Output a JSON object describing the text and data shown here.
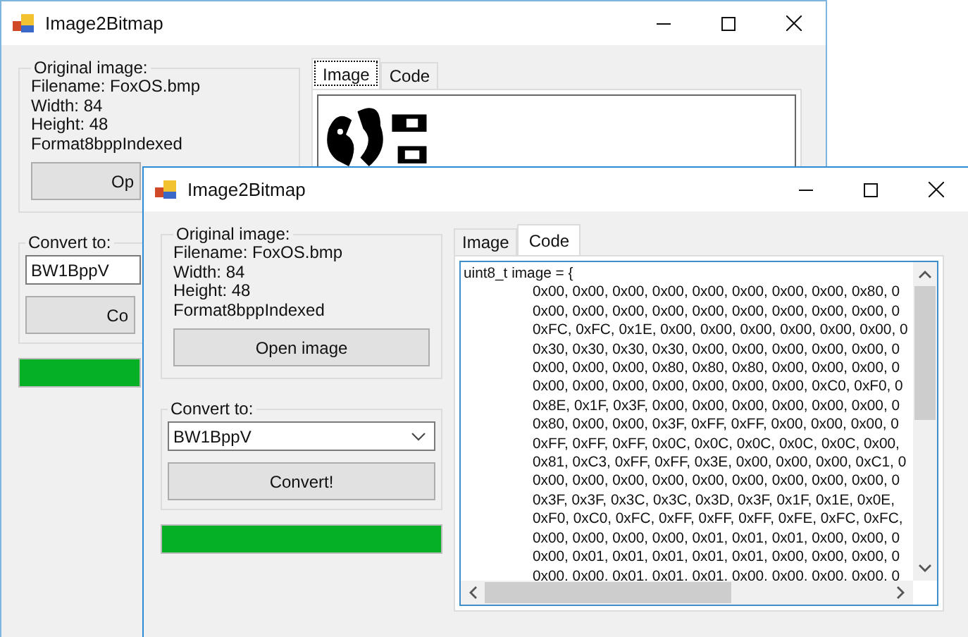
{
  "windows": [
    {
      "title": "Image2Bitmap",
      "active": false,
      "original_image": {
        "label": "Original image:",
        "lines": [
          "Filename: FoxOS.bmp",
          "Width:  84",
          "Height: 48",
          "Format8bppIndexed"
        ],
        "button": "Op"
      },
      "convert": {
        "label": "Convert to:",
        "value": "BW1BppV",
        "button": "Co"
      },
      "progress": {
        "level": 1
      },
      "tabs": [
        {
          "label": "Image",
          "selected": true
        },
        {
          "label": "Code",
          "selected": false
        }
      ]
    },
    {
      "title": "Image2Bitmap",
      "active": true,
      "original_image": {
        "label": "Original image:",
        "lines": [
          "Filename: FoxOS.bmp",
          "Width:  84",
          "Height: 48",
          "Format8bppIndexed"
        ],
        "button": "Open image"
      },
      "convert": {
        "label": "Convert to:",
        "value": "BW1BppV",
        "button": "Convert!"
      },
      "progress": {
        "level": 1
      },
      "tabs": [
        {
          "label": "Image",
          "selected": false
        },
        {
          "label": "Code",
          "selected": true
        }
      ],
      "panel": {
        "kind": "code",
        "lines": [
          "uint8_t image = {",
          "0x00, 0x00, 0x00, 0x00, 0x00, 0x00, 0x00, 0x00, 0x80, 0",
          "0x00, 0x00, 0x00, 0x00, 0x00, 0x00, 0x00, 0x00, 0x00, 0",
          "0xFC, 0xFC, 0x1E, 0x00, 0x00, 0x00, 0x00, 0x00, 0x00, 0",
          "0x30, 0x30, 0x30, 0x30, 0x00, 0x00, 0x00, 0x00, 0x00, 0",
          "0x00, 0x00, 0x00, 0x80, 0x80, 0x80, 0x00, 0x00, 0x00, 0",
          "0x00, 0x00, 0x00, 0x00, 0x00, 0x00, 0x00, 0xC0, 0xF0, 0",
          "0x8E, 0x1F, 0x3F, 0x00, 0x00, 0x00, 0x00, 0x00, 0x00, 0",
          "0x80, 0x00, 0x00, 0x3F, 0xFF, 0xFF, 0x00, 0x00, 0x00, 0",
          "0xFF, 0xFF, 0xFF, 0x0C, 0x0C, 0x0C, 0x0C, 0x0C, 0x00,",
          "0x81, 0xC3, 0xFF, 0xFF, 0x3E, 0x00, 0x00, 0x00, 0xC1, 0",
          "0x00, 0x00, 0x00, 0x00, 0x00, 0x00, 0x00, 0x00, 0x00, 0",
          "0x3F, 0x3F, 0x3C, 0x3C, 0x3D, 0x3F, 0x1F, 0x1E, 0x0E,",
          "0xF0, 0xC0, 0xFC, 0xFF, 0xFF, 0xFF, 0xFE, 0xFC, 0xFC,",
          "0x00, 0x00, 0x00, 0x00, 0x01, 0x01, 0x01, 0x00, 0x00, 0",
          "0x00, 0x01, 0x01, 0x01, 0x01, 0x01, 0x00, 0x00, 0x00, 0",
          "0x00, 0x00, 0x01, 0x01, 0x01, 0x00, 0x00, 0x00, 0x00, 0"
        ]
      }
    }
  ]
}
